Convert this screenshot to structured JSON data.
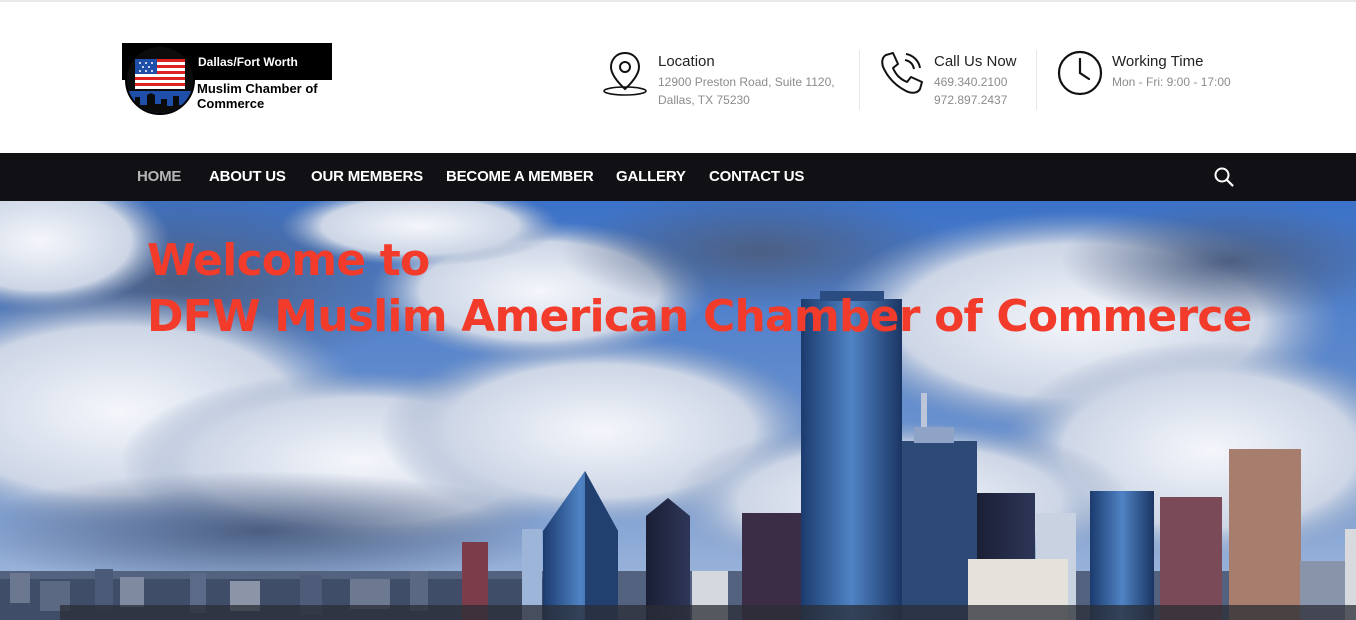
{
  "brand": {
    "line1": "Dallas/Fort Worth",
    "line2a": "Muslim Chamber of",
    "line2b": "Commerce"
  },
  "contact": {
    "location": {
      "title": "Location",
      "line1": "12900 Preston Road, Suite 1120,",
      "line2": "Dallas, TX 75230",
      "icon": "map-pin-icon"
    },
    "phone": {
      "title": "Call Us Now",
      "line1": "469.340.2100",
      "line2": "972.897.2437",
      "icon": "phone-icon"
    },
    "hours": {
      "title": "Working Time",
      "line1": "Mon - Fri: 9:00 - 17:00",
      "icon": "clock-icon"
    }
  },
  "nav": {
    "items": [
      {
        "label": "HOME",
        "active": true
      },
      {
        "label": "ABOUT US"
      },
      {
        "label": "OUR MEMBERS"
      },
      {
        "label": "BECOME A MEMBER"
      },
      {
        "label": "GALLERY"
      },
      {
        "label": "CONTACT US"
      }
    ],
    "search_icon": "search-icon"
  },
  "hero": {
    "title_line1": "Welcome to",
    "title_line2": "DFW Muslim American Chamber of Commerce"
  },
  "colors": {
    "nav_bg": "#111115",
    "accent": "#f23b2a",
    "nav_active": "#b5b5b5"
  }
}
